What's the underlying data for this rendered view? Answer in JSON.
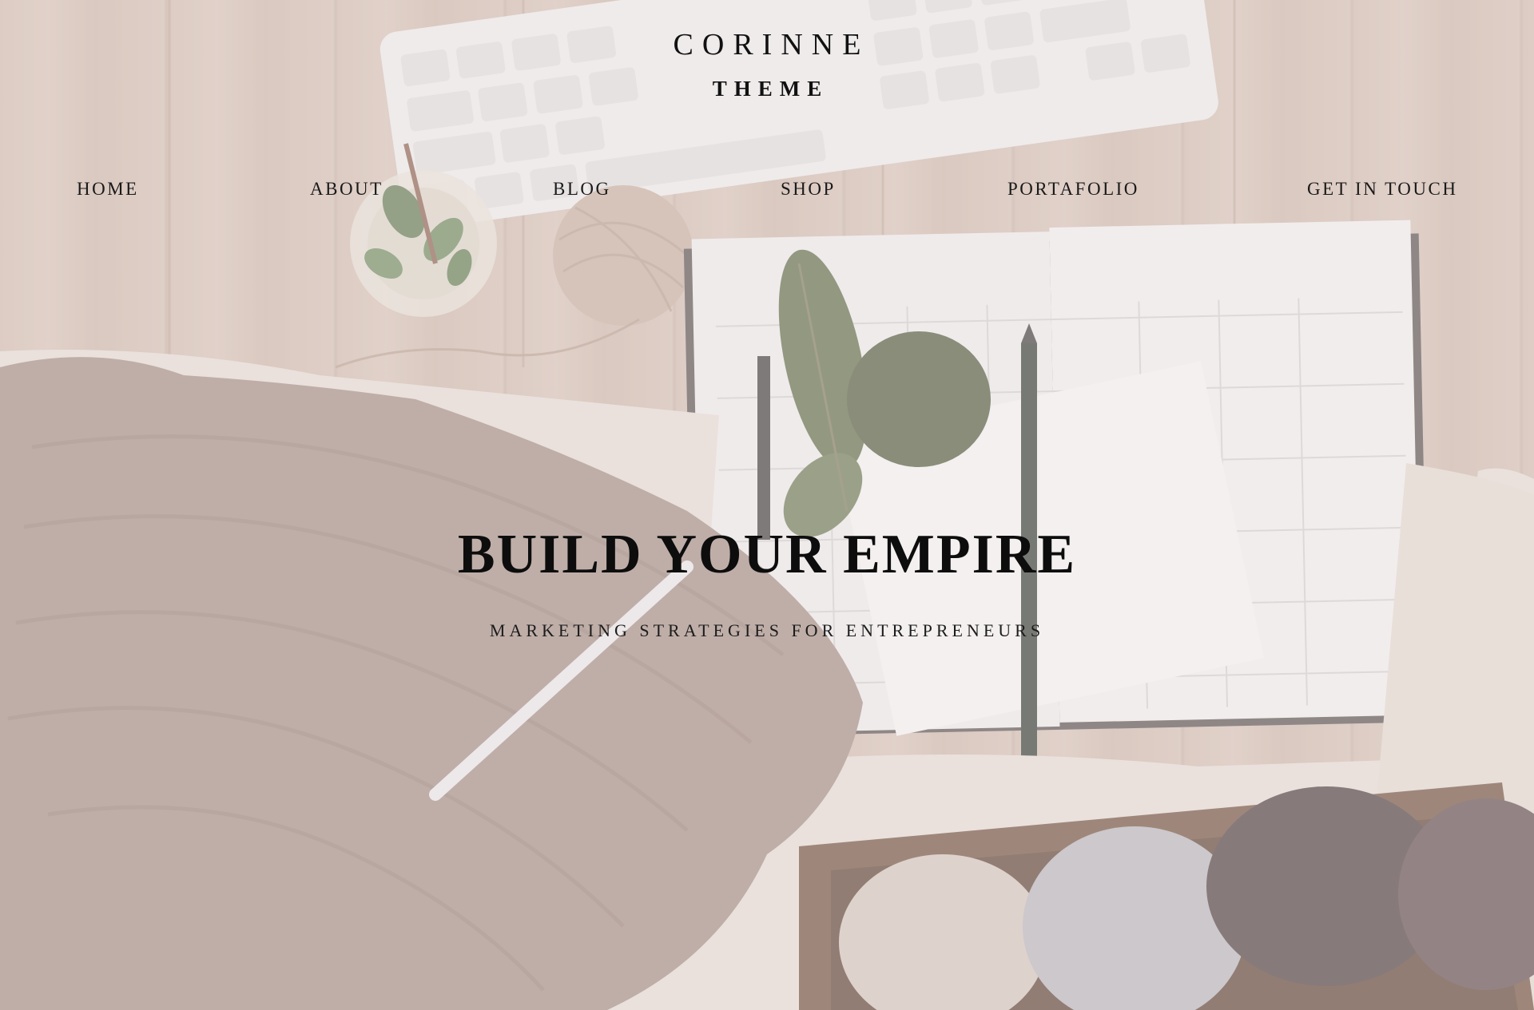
{
  "site": {
    "title": "CORINNE",
    "subtitle": "THEME"
  },
  "nav": {
    "items": [
      {
        "label": "HOME"
      },
      {
        "label": "ABOUT"
      },
      {
        "label": "BLOG"
      },
      {
        "label": "SHOP"
      },
      {
        "label": "PORTAFOLIO"
      },
      {
        "label": "GET IN TOUCH"
      }
    ]
  },
  "hero": {
    "title": "BUILD YOUR EMPIRE",
    "tagline": "MARKETING STRATEGIES FOR ENTREPRENEURS"
  },
  "colors": {
    "text": "#111111",
    "overlay": "#ece2e0",
    "wood": "#d3bfb3",
    "knit": "#a58f86"
  }
}
